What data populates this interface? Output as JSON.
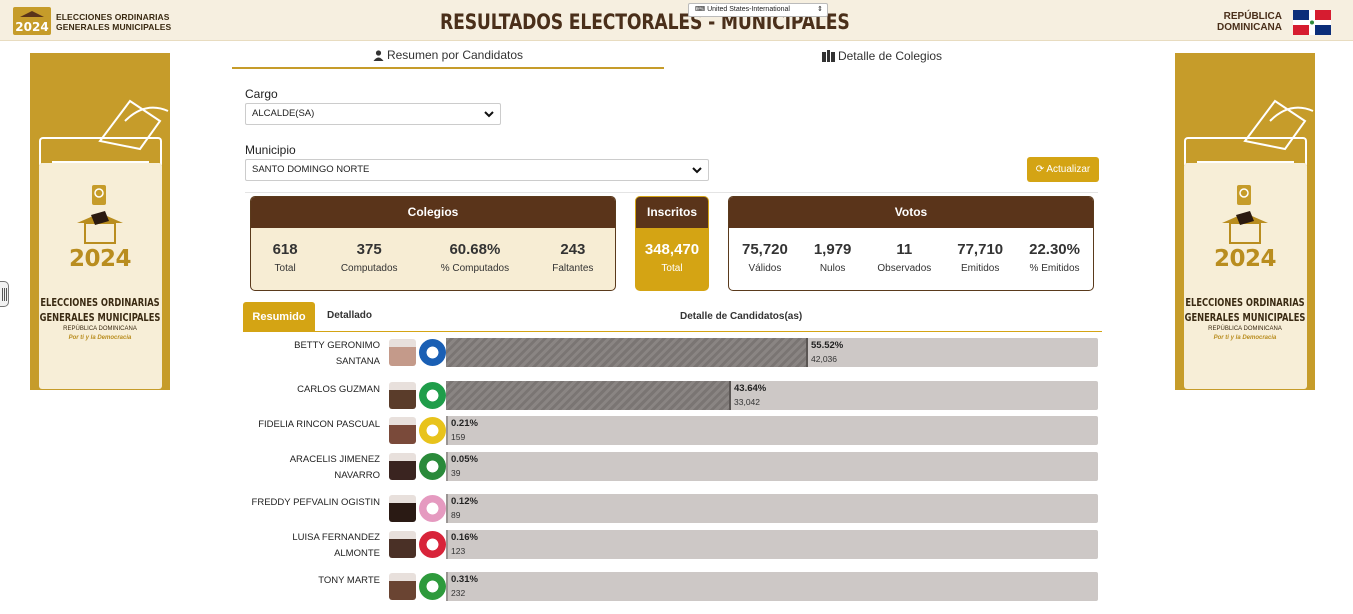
{
  "header": {
    "logo_line1": "ELECCIONES ORDINARIAS",
    "logo_line2": "GENERALES MUNICIPALES",
    "title": "RESULTADOS ELECTORALES - MUNICIPALES",
    "keyboard_layout": "United States-International",
    "country_line1": "REPÚBLICA",
    "country_line2": "DOMINICANA"
  },
  "banner": {
    "year": "2024",
    "line1": "ELECCIONES ORDINARIAS",
    "line2": "GENERALES MUNICIPALES",
    "sub": "REPÚBLICA DOMINICANA",
    "motto": "Por ti y la Democracia"
  },
  "tabs": {
    "resumen": "Resumen por Candidatos",
    "colegios": "Detalle de Colegios"
  },
  "filters": {
    "cargo_label": "Cargo",
    "cargo_value": "ALCALDE(SA)",
    "municipio_label": "Municipio",
    "municipio_value": "SANTO DOMINGO NORTE",
    "update_button": "Actualizar"
  },
  "colegios": {
    "title": "Colegios",
    "stats": [
      {
        "value": "618",
        "label": "Total"
      },
      {
        "value": "375",
        "label": "Computados"
      },
      {
        "value": "60.68%",
        "label": "% Computados"
      },
      {
        "value": "243",
        "label": "Faltantes"
      }
    ]
  },
  "inscritos": {
    "title": "Inscritos",
    "value": "348,470",
    "label": "Total"
  },
  "votos": {
    "title": "Votos",
    "stats": [
      {
        "value": "75,720",
        "label": "Válidos"
      },
      {
        "value": "1,979",
        "label": "Nulos"
      },
      {
        "value": "11",
        "label": "Observados"
      },
      {
        "value": "77,710",
        "label": "Emitidos"
      },
      {
        "value": "22.30%",
        "label": "% Emitidos"
      }
    ]
  },
  "subtabs": {
    "resumido": "Resumido",
    "detallado": "Detallado",
    "detail_title": "Detalle de Candidatos(as)"
  },
  "candidates": [
    {
      "name_line1": "BETTY GERONIMO",
      "name_line2": "SANTANA",
      "pct": "55.52%",
      "share": 55.52,
      "votes": "42,036",
      "party_color": "#1a5fb4",
      "photo_color": "#c49a8a"
    },
    {
      "name_line1": "CARLOS GUZMAN",
      "name_line2": "",
      "pct": "43.64%",
      "share": 43.64,
      "votes": "33,042",
      "party_color": "#1f9d4a",
      "photo_color": "#5a3c2a"
    },
    {
      "name_line1": "FIDELIA RINCON PASCUAL",
      "name_line2": "",
      "pct": "0.21%",
      "share": 0.21,
      "votes": "159",
      "party_color": "#e8c31c",
      "photo_color": "#7a4a3a"
    },
    {
      "name_line1": "ARACELIS JIMENEZ",
      "name_line2": "NAVARRO",
      "pct": "0.05%",
      "share": 0.05,
      "votes": "39",
      "party_color": "#2a8a3a",
      "photo_color": "#3a2420"
    },
    {
      "name_line1": "FREDDY PEFVALIN OGISTIN",
      "name_line2": "",
      "pct": "0.12%",
      "share": 0.12,
      "votes": "89",
      "party_color": "#e59ac0",
      "photo_color": "#2a1a14"
    },
    {
      "name_line1": "LUISA FERNANDEZ",
      "name_line2": "ALMONTE",
      "pct": "0.16%",
      "share": 0.16,
      "votes": "123",
      "party_color": "#d8243a",
      "photo_color": "#4a3026"
    },
    {
      "name_line1": "TONY MARTE",
      "name_line2": "",
      "pct": "0.31%",
      "share": 0.31,
      "votes": "232",
      "party_color": "#2e9a3c",
      "photo_color": "#6a4432"
    }
  ],
  "colors": {
    "gold": "#d4a414",
    "banner_gold": "#c69c2a",
    "brown": "#5a341a",
    "cream": "#f7edd4"
  }
}
